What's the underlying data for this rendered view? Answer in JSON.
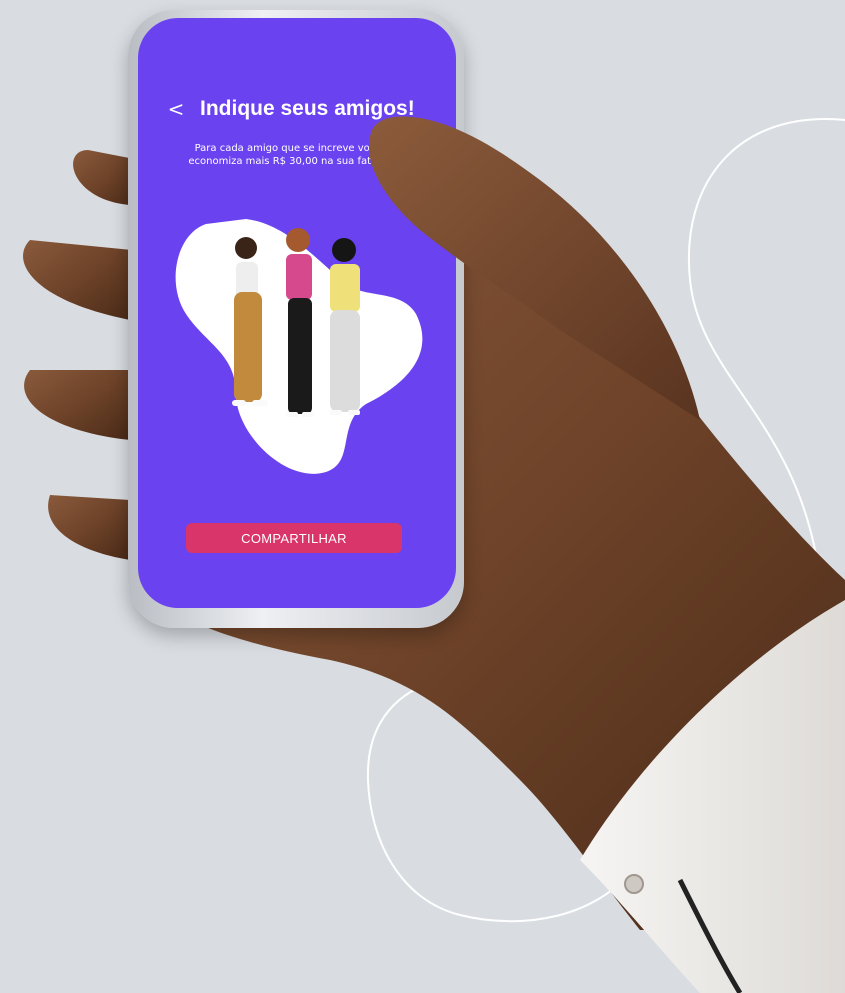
{
  "screen": {
    "header": {
      "back_icon": "chevron-left-icon",
      "back_label": "<",
      "title": "Indique seus amigos!"
    },
    "subtitle": "Para cada amigo que se increve você economiza mais R$ 30,00 na sua fatura",
    "illustration": "three-friends-illustration",
    "share_button_label": "COMPARTILHAR"
  },
  "colors": {
    "screen_bg": "#6a42f0",
    "button_bg": "#d9356a",
    "page_bg": "#d9dde2"
  }
}
